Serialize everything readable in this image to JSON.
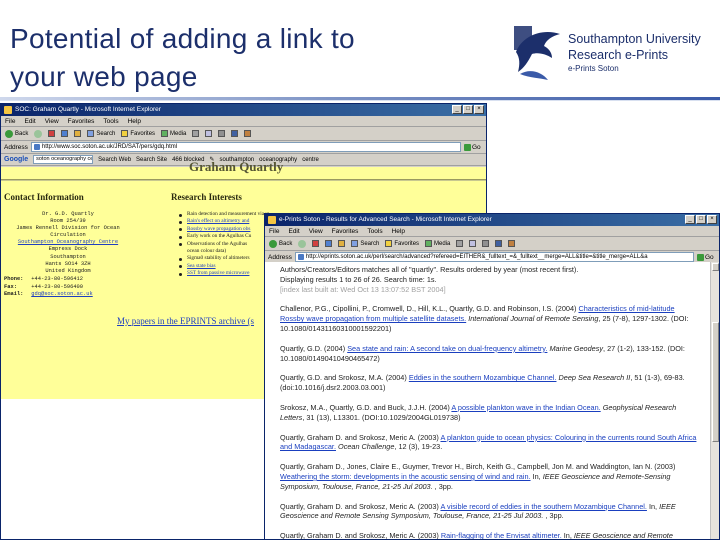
{
  "slide": {
    "title_line1": "Potential of adding a link to",
    "title_line2": "your web page"
  },
  "logo": {
    "line1": "Southampton University",
    "line2": "Research e-Prints",
    "line3": "e-Prints Soton"
  },
  "window1": {
    "title": "SOC: Graham Quartly - Microsoft Internet Explorer",
    "menu": [
      "File",
      "Edit",
      "View",
      "Favorites",
      "Tools",
      "Help"
    ],
    "toolbar": [
      "Back",
      "",
      "",
      "",
      "",
      "Search",
      "Favorites",
      "Media",
      "",
      "",
      "",
      "",
      ""
    ],
    "address_label": "Address",
    "address_value": "http://www.soc.soton.ac.uk/JRD/SAT/pers/gdq.html",
    "go_label": "Go",
    "google_label": "Google",
    "google_query": "soton oceanography centre",
    "google_buttons": [
      "Search Web",
      "Search Site",
      "466 blocked",
      "",
      "southampton",
      "oceanography",
      "centre"
    ],
    "page_name": "Graham Quartly",
    "contact_heading": "Contact Information",
    "research_heading": "Research Interests",
    "address_lines": [
      "Dr. G.D. Quartly",
      "Room 254/39",
      "James Rennell Division for Ocean Circulation",
      "Southampton Oceanography Centre",
      "Empress Dock",
      "Southampton",
      "Hants   SO14 3ZH",
      "United Kingdom"
    ],
    "phone_label": "Phone:",
    "phone": "+44-23-80-596412",
    "fax_label": "Fax:",
    "fax": "+44-23-80-596400",
    "email_label": "Email:",
    "email": "gdq@soc.soton.ac.uk",
    "interests": [
      "Rain detection and measurement via underwater acoustics",
      "Rain's effect on altimetry and",
      "Rossby wave propagation obs",
      "Early work on the Agulhas Cu",
      "Observations of the Agulhas",
      "ocean colour data)",
      "Sigma0 stability of altimeters",
      "Sea state bias",
      "SST from passive microwave"
    ],
    "eprints_link": "My papers in the EPRINTS archive (s"
  },
  "window2": {
    "title": "e-Prints Soton - Results for Advanced Search - Microsoft Internet Explorer",
    "menu": [
      "File",
      "Edit",
      "View",
      "Favorites",
      "Tools",
      "Help"
    ],
    "toolbar": [
      "Back",
      "",
      "",
      "",
      "",
      "Search",
      "Favorites",
      "Media",
      "",
      "",
      "",
      "",
      ""
    ],
    "address_label": "Address",
    "address_value": "http://eprints.soton.ac.uk/perl/search/advanced?refereed=EITHER&_fulltext_=&_fulltext__merge=ALL&title=&title_merge=ALL&a",
    "go_label": "Go",
    "meta_line1": "Authors/Creators/Editors matches all of \"quartly\". Results ordered by year (most recent first).",
    "meta_line2": "Displaying results 1 to 26 of 26. Search time: 1s.",
    "meta_line3": "[index last built at: Wed Oct 13 13:07:52 BST 2004]",
    "refs": [
      {
        "a": "Challenor, P.G., Cipollini, P., Cromwell, D., Hill, K.L., Quartly, G.D. and Robinson, I.S. (2004) ",
        "link": "Characteristics of mid-latitude Rossby wave propagation from multiple satellite datasets.",
        "b": " ",
        "journal": "International Journal of Remote Sensing",
        "c": ", 25 (7-8), 1297-1302. (DOI: 10.1080/01431160310001592201)"
      },
      {
        "a": "Quartly, G.D. (2004) ",
        "link": "Sea state and rain: A second take on dual-frequency altimetry.",
        "b": " ",
        "journal": "Marine Geodesy",
        "c": ", 27 (1-2), 133-152. (DOI: 10.1080/01490410490465472)"
      },
      {
        "a": "Quartly, G.D. and Srokosz, M.A. (2004) ",
        "link": "Eddies in the southern Mozambique Channel.",
        "b": " ",
        "journal": "Deep Sea Research II",
        "c": ", 51 (1-3), 69-83. (doi:10.1016/j.dsr2.2003.03.001)"
      },
      {
        "a": "Srokosz, M.A., Quartly, G.D. and Buck, J.J.H. (2004) ",
        "link": "A possible plankton wave in the Indian Ocean.",
        "b": " ",
        "journal": "Geophysical Research Letters",
        "c": ", 31 (13), L13301. (DOI:10.1029/2004GL019738)"
      },
      {
        "a": "Quartly, Graham D. and Srokosz, Meric A. (2003) ",
        "link": "A plankton guide to ocean physics: Colouring in the currents round South Africa and Madagascar.",
        "b": " ",
        "journal": "Ocean Challenge",
        "c": ", 12 (3), 19-23."
      },
      {
        "a": "Quartly, Graham D., Jones, Claire E., Guymer, Trevor H., Birch, Keith G., Campbell, Jon M. and Waddington, Ian N. (2003) ",
        "link": "Weathering the storm: developments in the acoustic sensing of wind and rain.",
        "b": " In, ",
        "journal": "IEEE Geoscience and Remote-Sensing Symposium, Toulouse, France, 21-25 Jul 2003.",
        "c": " , 3pp."
      },
      {
        "a": "Quartly, Graham D. and Srokosz, Meric A. (2003) ",
        "link": "A visible record of eddies in the southern Mozambique Channel.",
        "b": " In, ",
        "journal": "IEEE Geoscience and Remote Sensing Symposium, Toulouse, France, 21-25 Jul 2003.",
        "c": " , 3pp."
      },
      {
        "a": "Quartly, Graham D. and Srokosz, Meric A. (2003) ",
        "link": "Rain-flagging of the Envisat altimeter.",
        "b": " In, ",
        "journal": "IEEE Geoscience and Remote",
        "c": ""
      }
    ]
  },
  "colors": {
    "title": "#1c2f6b",
    "ie_titlebar": "#0a246a",
    "page1_bg": "#ffff99",
    "link": "#1a3fbf"
  }
}
